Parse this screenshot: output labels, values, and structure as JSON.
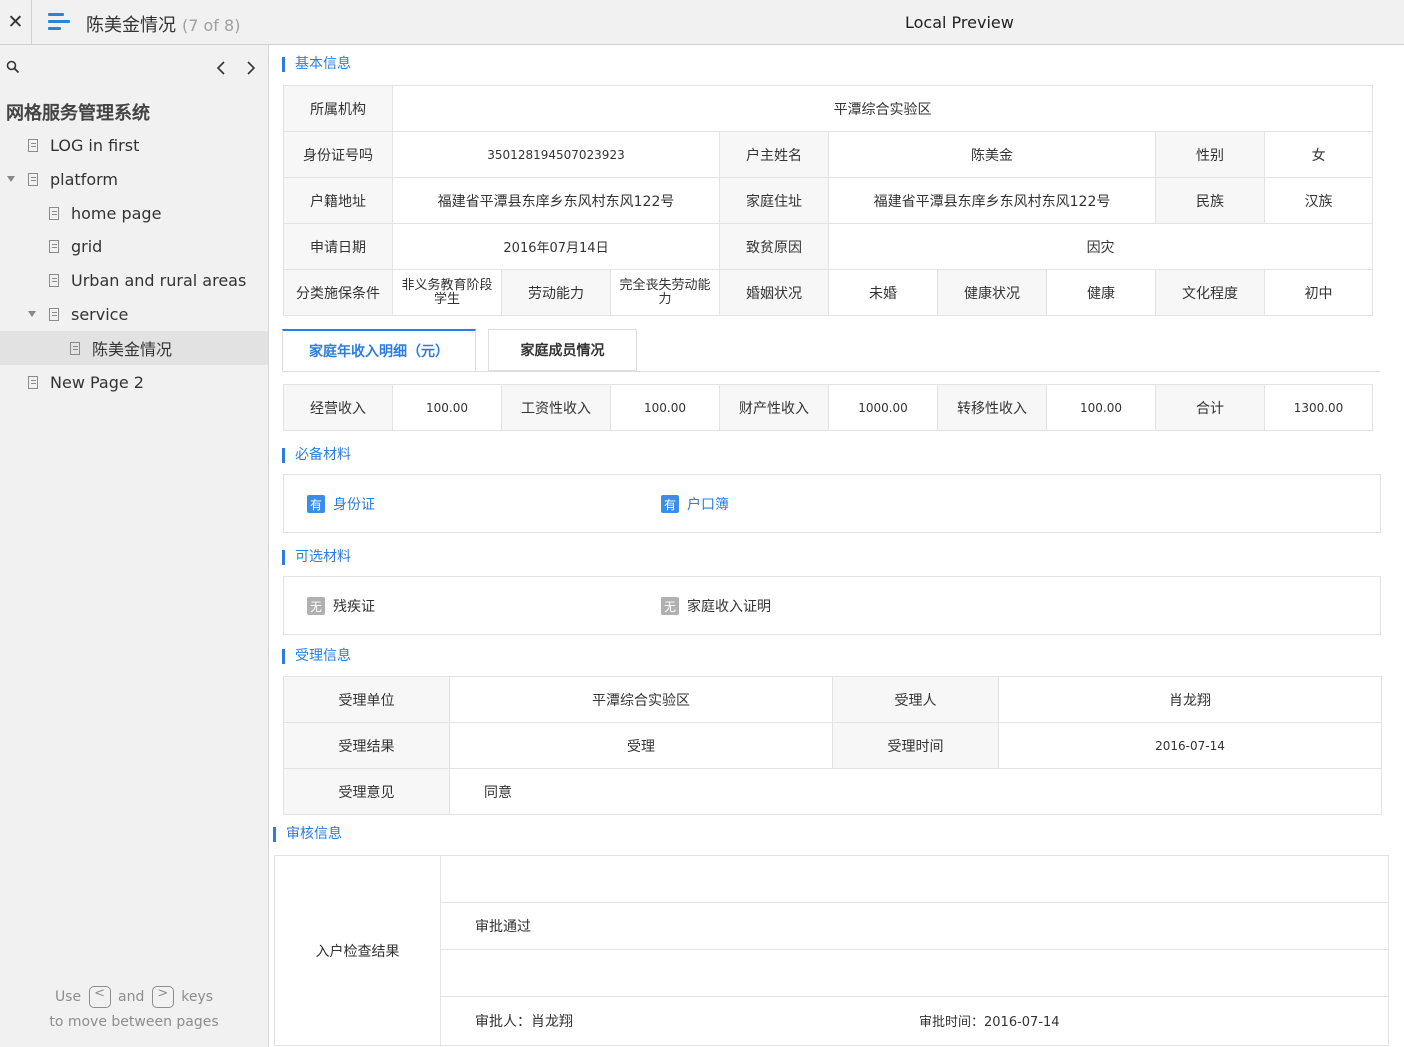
{
  "topbar": {
    "title": "陈美金情况",
    "page_count": "(7 of 8)",
    "preview_label": "Local Preview"
  },
  "sidebar": {
    "root": "网格服务管理系统",
    "items": [
      {
        "label": "LOG in first"
      },
      {
        "label": "platform"
      },
      {
        "label": "home page"
      },
      {
        "label": "grid"
      },
      {
        "label": "Urban and rural areas"
      },
      {
        "label": "service"
      },
      {
        "label": "陈美金情况"
      },
      {
        "label": "New Page 2"
      }
    ],
    "hint_use": "Use",
    "hint_and": "and",
    "hint_keys": "keys",
    "hint_line2": "to move between pages",
    "key_prev": "<",
    "key_next": ">"
  },
  "basic": {
    "title": "基本信息",
    "org_label": "所属机构",
    "org": "平潭综合实验区",
    "id_label": "身份证号吗",
    "id": "350128194507023923",
    "householder_label": "户主姓名",
    "householder": "陈美金",
    "gender_label": "性别",
    "gender": "女",
    "huji_label": "户籍地址",
    "huji": "福建省平潭县东庠乡东风村东风122号",
    "home_label": "家庭住址",
    "home": "福建省平潭县东庠乡东风村东风122号",
    "ethnic_label": "民族",
    "ethnic": "汉族",
    "apply_label": "申请日期",
    "apply": "2016年07月14日",
    "cause_label": "致贫原因",
    "cause": "因灾",
    "cat_label": "分类施保条件",
    "cat": "非义务教育阶段学生",
    "labor_label": "劳动能力",
    "labor": "完全丧失劳动能力",
    "marital_label": "婚姻状况",
    "marital": "未婚",
    "health_label": "健康状况",
    "health": "健康",
    "edu_label": "文化程度",
    "edu": "初中"
  },
  "tabs": [
    {
      "label": "家庭年收入明细（元）"
    },
    {
      "label": "家庭成员情况"
    }
  ],
  "income": {
    "op_label": "经营收入",
    "op": "100.00",
    "wage_label": "工资性收入",
    "wage": "100.00",
    "prop_label": "财产性收入",
    "prop": "1000.00",
    "trans_label": "转移性收入",
    "trans": "100.00",
    "total_label": "合计",
    "total": "1300.00"
  },
  "required": {
    "title": "必备材料",
    "items": [
      {
        "badge": "有",
        "label": "身份证"
      },
      {
        "badge": "有",
        "label": "户口簿"
      }
    ]
  },
  "optional": {
    "title": "可选材料",
    "items": [
      {
        "badge": "无",
        "label": "残疾证"
      },
      {
        "badge": "无",
        "label": "家庭收入证明"
      }
    ]
  },
  "accept": {
    "title": "受理信息",
    "unit_label": "受理单位",
    "unit": "平潭综合实验区",
    "person_label": "受理人",
    "person": "肖龙翔",
    "result_label": "受理结果",
    "result": "受理",
    "time_label": "受理时间",
    "time": "2016-07-14",
    "opinion_label": "受理意见",
    "opinion": "同意"
  },
  "review": {
    "title": "审核信息",
    "check_label": "入户检查结果",
    "status": "审批通过",
    "approver": "审批人：肖龙翔",
    "approve_time": "审批时间：2016-07-14"
  },
  "colors": {
    "accent": "#2b7de0",
    "yes_badge": "#3d8de5",
    "no_badge": "#b0b0b0"
  }
}
